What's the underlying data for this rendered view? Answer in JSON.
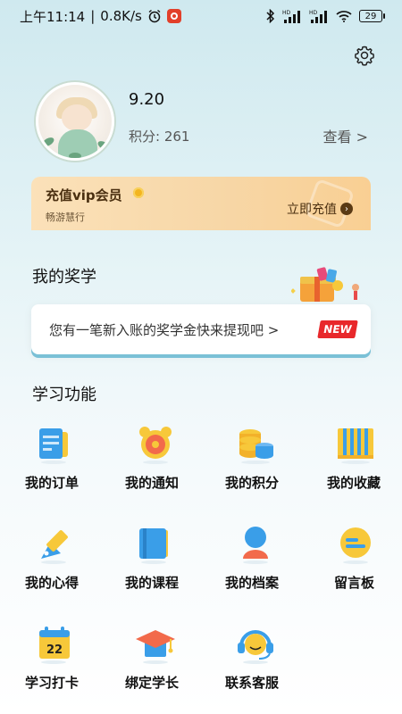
{
  "status": {
    "time": "上午11:14",
    "speed": "0.8K/s",
    "battery": "29",
    "signal1": "HD",
    "signal2": "HD"
  },
  "profile": {
    "username": "9.20",
    "points_label": "积分: 261",
    "view_link": "查看 >"
  },
  "vip": {
    "title": "充值vip会员",
    "subtitle": "畅游慧行",
    "action": "立即充值"
  },
  "scholarship": {
    "title": "我的奖学",
    "message": "您有一笔新入账的奖学金快来提现吧 >",
    "badge": "NEW"
  },
  "learning": {
    "title": "学习功能",
    "items": [
      {
        "label": "我的订单",
        "icon": "order-icon"
      },
      {
        "label": "我的通知",
        "icon": "alarm-clock-icon"
      },
      {
        "label": "我的积分",
        "icon": "coins-icon"
      },
      {
        "label": "我的收藏",
        "icon": "favorites-icon"
      },
      {
        "label": "我的心得",
        "icon": "pen-icon"
      },
      {
        "label": "我的课程",
        "icon": "book-icon"
      },
      {
        "label": "我的档案",
        "icon": "profile-icon"
      },
      {
        "label": "留言板",
        "icon": "message-board-icon"
      },
      {
        "label": "学习打卡",
        "icon": "calendar-icon"
      },
      {
        "label": "绑定学长",
        "icon": "graduation-cap-icon"
      },
      {
        "label": "联系客服",
        "icon": "headset-icon"
      }
    ]
  },
  "calendar_day": "22",
  "colors": {
    "accent_blue": "#3a9ee8",
    "accent_yellow": "#f7c83a",
    "accent_red": "#e8282b",
    "vip_gradient": "#f9cf93"
  }
}
